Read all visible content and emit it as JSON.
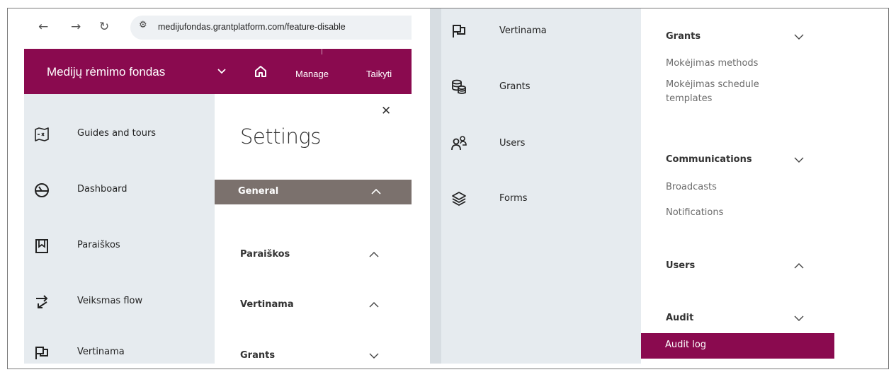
{
  "browser": {
    "url": "medijufondas.grantplatform.com/feature-disable",
    "back_icon": "back-arrow-icon",
    "forward_icon": "forward-arrow-icon",
    "reload_icon": "reload-icon",
    "site_info_icon": "site-settings-icon"
  },
  "appbar": {
    "brand": "Medijų rėmimo fondas",
    "nav": [
      "Manage",
      "Taikyti"
    ],
    "color": "#8a0a4f"
  },
  "sidebar_left": {
    "items": [
      {
        "label": "Guides and tours",
        "icon": "map-icon"
      },
      {
        "label": "Dashboard",
        "icon": "gauge-icon"
      },
      {
        "label": "Paraiškos",
        "icon": "bookmark-box-icon"
      },
      {
        "label": "Veiksmas flow",
        "icon": "flow-arrows-icon"
      },
      {
        "label": "Vertinama",
        "icon": "flag-icon"
      }
    ]
  },
  "settings": {
    "title": "Settings",
    "close_icon": "close-icon",
    "sections": [
      {
        "label": "General",
        "state": "expanded-active"
      },
      {
        "label": "Paraiškos",
        "state": "expanded"
      },
      {
        "label": "Vertinama",
        "state": "expanded"
      },
      {
        "label": "Grants",
        "state": "collapsed"
      }
    ]
  },
  "sidebar_right": {
    "items": [
      {
        "label": "Vertinama",
        "icon": "flag-icon"
      },
      {
        "label": "Grants",
        "icon": "coins-icon"
      },
      {
        "label": "Users",
        "icon": "users-icon"
      },
      {
        "label": "Forms",
        "icon": "layers-icon"
      }
    ]
  },
  "menu_right": {
    "groups": [
      {
        "label": "Grants",
        "state": "collapsed",
        "items": [
          "Mokėjimas methods",
          "Mokėjimas schedule templates"
        ]
      },
      {
        "label": "Communications",
        "state": "collapsed",
        "items": [
          "Broadcasts",
          "Notifications"
        ]
      },
      {
        "label": "Users",
        "state": "expanded",
        "items": []
      },
      {
        "label": "Audit",
        "state": "collapsed",
        "items": [
          "Audit log"
        ]
      }
    ],
    "active_item": "Audit log"
  }
}
